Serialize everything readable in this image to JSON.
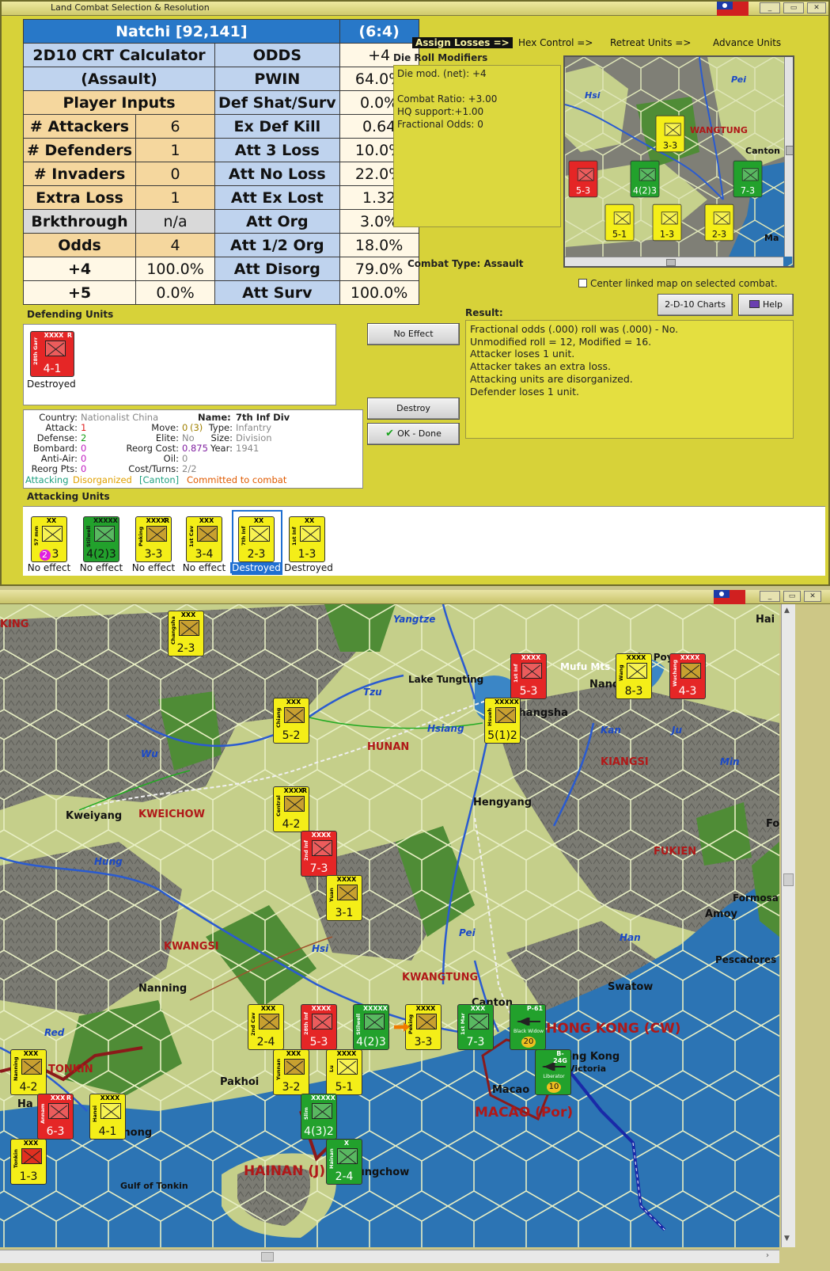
{
  "dialog": {
    "title": "Land Combat Selection & Resolution",
    "crt": {
      "location": "Natchi [92,141]",
      "ratio": "(6:4)",
      "calc_title1": "2D10 CRT Calculator",
      "calc_title2": "(Assault)",
      "player_inputs": "Player Inputs",
      "inputs": [
        {
          "label": "# Attackers",
          "value": "6"
        },
        {
          "label": "# Defenders",
          "value": "1"
        },
        {
          "label": "# Invaders",
          "value": "0"
        },
        {
          "label": "Extra Loss",
          "value": "1"
        },
        {
          "label": "Brkthrough",
          "value": "n/a"
        },
        {
          "label": "Odds",
          "value": "4"
        },
        {
          "label": "+4",
          "value": "100.0%"
        },
        {
          "label": "+5",
          "value": "0.0%"
        }
      ],
      "results": [
        {
          "label": "ODDS",
          "value": "+4"
        },
        {
          "label": "PWIN",
          "value": "64.0%"
        },
        {
          "label": "Def Shat/Surv",
          "value": "0.0%"
        },
        {
          "label": "Ex Def Kill",
          "value": "0.64"
        },
        {
          "label": "Att 3 Loss",
          "value": "10.0%"
        },
        {
          "label": "Att No Loss",
          "value": "22.0%"
        },
        {
          "label": "Att Ex Lost",
          "value": "1.32"
        },
        {
          "label": "Att Org",
          "value": "3.0%"
        },
        {
          "label": "Att 1/2 Org",
          "value": "18.0%"
        },
        {
          "label": "Att Disorg",
          "value": "79.0%"
        },
        {
          "label": "Att Surv",
          "value": "100.0%"
        }
      ]
    },
    "steps": {
      "assign": "Assign Losses =>",
      "hex": "Hex Control =>",
      "retreat": "Retreat Units =>",
      "advance": "Advance Units"
    },
    "drm": {
      "title": "Die Roll Modifiers",
      "lines": [
        "Die mod. (net): +4",
        "",
        "Combat Ratio: +3.00",
        "HQ support:+1.00",
        "Fractional Odds: 0"
      ]
    },
    "combat_type_label": "Combat Type:",
    "combat_type_value": "Assault",
    "center_link": "Center linked map on selected combat.",
    "buttons": {
      "charts": "2-D-10 Charts",
      "help": "Help",
      "no_effect": "No Effect",
      "destroy": "Destroy",
      "ok": "OK - Done"
    },
    "result": {
      "label": "Result:",
      "lines": [
        "Fractional odds (.000) roll was (.000)  - No.",
        "Unmodified roll = 12, Modified = 16.",
        "Attacker loses 1 unit.",
        "Attacker takes an extra loss.",
        "Attacking units are disorganized.",
        "Defender loses 1 unit."
      ]
    },
    "defending": {
      "label": "Defending Units",
      "units": [
        {
          "name": "28th Garr",
          "size": "XXXX",
          "strength": "4-1",
          "flag": "R",
          "status": "Destroyed",
          "color": "#e52626"
        }
      ]
    },
    "info": {
      "country_label": "Country:",
      "country": "Nationalist China",
      "attack_label": "Attack:",
      "attack": "1",
      "defense_label": "Defense:",
      "defense": "2",
      "bombard_label": "Bombard:",
      "bombard": "0",
      "antiair_label": "Anti-Air:",
      "antiair": "0",
      "reorg_label": "Reorg Pts:",
      "reorg": "0",
      "move_label": "Move:",
      "move": "0",
      "move_paren": "(3)",
      "elite_label": "Elite:",
      "elite": "No",
      "reorg_cost_label": "Reorg Cost:",
      "reorg_cost": "0.875",
      "oil_label": "Oil:",
      "oil": "0",
      "cost_label": "Cost/Turns:",
      "cost": "2/2",
      "name_label": "Name:",
      "name": "7th Inf Div",
      "type_label": "Type:",
      "type": "Infantry",
      "size_label": "Size:",
      "size": "Division",
      "year_label": "Year:",
      "year": "1941",
      "status_attacking": "Attacking",
      "status_disorganized": "Disorganized",
      "status_location": "[Canton]",
      "status_committed": "Committed to combat"
    },
    "attacking": {
      "label": "Attacking Units",
      "units": [
        {
          "name": "57 mm",
          "size": "XX",
          "strength": "3",
          "extra": "2",
          "color": "y",
          "status": "No effect"
        },
        {
          "name": "Stilwell",
          "size": "XXXXX",
          "strength": "4(2)3",
          "color": "g",
          "status": "No effect"
        },
        {
          "name": "Peking",
          "size": "XXXX",
          "strength": "3-3",
          "flag": "R",
          "color": "y",
          "status": "No effect"
        },
        {
          "name": "1st Cav",
          "size": "XXX",
          "strength": "3-4",
          "color": "y",
          "status": "No effect"
        },
        {
          "name": "7th Inf Div",
          "size": "XX",
          "strength": "2-3",
          "color": "y",
          "status": "Destroyed",
          "selected": true
        },
        {
          "name": "1st Inf Div",
          "size": "XX",
          "strength": "1-3",
          "color": "y",
          "status": "Destroyed"
        }
      ]
    }
  },
  "map": {
    "provinces": [
      "HUNAN",
      "KWEICHOW",
      "KIANGSI",
      "FUKIEN",
      "KWANGSI",
      "KWANGTUNG",
      "HONG KONG (CW)",
      "MACAO (Por)",
      "HAINAN (J)",
      "TONKIN",
      "KING"
    ],
    "cities": [
      "Kweiyang",
      "Hengyang",
      "Nanning",
      "Swatow",
      "Canton",
      "Amoy",
      "Pakhoi",
      "Macao",
      "Hong Kong",
      "Victoria",
      "Haiphong",
      "Kiungchow",
      "Nanc",
      "Changsha",
      "Ha",
      "Fo",
      "Hai"
    ],
    "geo": [
      "Lake Tungting",
      "Mufu Mts",
      "Lake Poyang",
      "Formosa",
      "Pescadores",
      "Gulf of Tonkin"
    ],
    "rivers": [
      "Yangtze",
      "Tzu",
      "Hsiang",
      "Kan",
      "Ju",
      "Wu",
      "Min",
      "Hung",
      "Hsi",
      "Pei",
      "Han",
      "Red"
    ],
    "minimap_labels": [
      "Hsi",
      "Pei",
      "WANGTUNG",
      "Canton",
      "Ma"
    ],
    "units": [
      {
        "name": "Changsha",
        "size": "XXX",
        "strength": "2-3",
        "color": "y"
      },
      {
        "name": "1st Inf",
        "size": "XXXX",
        "strength": "5-3",
        "color": "r"
      },
      {
        "name": "Wang",
        "size": "XXXX",
        "strength": "8-3",
        "color": "y"
      },
      {
        "name": "Wuchang",
        "size": "XXXX",
        "strength": "4-3",
        "color": "r"
      },
      {
        "name": "Chiang",
        "size": "XXX",
        "strength": "5-2",
        "color": "y"
      },
      {
        "name": "Hsueh",
        "size": "XXXXX",
        "strength": "5(1)2",
        "color": "y"
      },
      {
        "name": "Central",
        "size": "XXXX",
        "strength": "4-2",
        "flag": "R",
        "color": "y"
      },
      {
        "name": "2nd Inf",
        "size": "XXXX",
        "strength": "7-3",
        "color": "r"
      },
      {
        "name": "Yuan",
        "size": "XXXX",
        "strength": "3-1",
        "color": "y"
      },
      {
        "name": "2nd Cav",
        "size": "XXX",
        "strength": "2-4",
        "color": "y"
      },
      {
        "name": "28th Inf",
        "size": "XXXX",
        "strength": "5-3",
        "color": "r"
      },
      {
        "name": "Stilwell",
        "size": "XXXXX",
        "strength": "4(2)3",
        "color": "g"
      },
      {
        "name": "Peking",
        "size": "XXXX",
        "strength": "3-3",
        "color": "y"
      },
      {
        "name": "1st Mar",
        "size": "XXX",
        "strength": "7-3",
        "color": "g"
      },
      {
        "name": "Yunnan",
        "size": "XXX",
        "strength": "3-2",
        "color": "y"
      },
      {
        "name": "Lu",
        "size": "XXXX",
        "strength": "5-1",
        "color": "y"
      },
      {
        "name": "Nanning",
        "size": "XXX",
        "strength": "4-2",
        "color": "y"
      },
      {
        "name": "Annam",
        "size": "XXX",
        "strength": "6-3",
        "flag": "R",
        "color": "r"
      },
      {
        "name": "Hanoi",
        "size": "XXXX",
        "strength": "4-1",
        "color": "y"
      },
      {
        "name": "Slim",
        "size": "XXXXX",
        "strength": "4(3)2",
        "color": "g"
      },
      {
        "name": "Hainan",
        "size": "X",
        "strength": "2-4",
        "color": "g"
      },
      {
        "name": "Tonkin",
        "size": "XXX",
        "strength": "1-3",
        "color": "y"
      }
    ],
    "air": [
      {
        "name": "Black Widow",
        "type": "P-61",
        "value": "20"
      },
      {
        "name": "Liberator",
        "type": "B-24G",
        "value": "10"
      }
    ]
  },
  "colors": {
    "dialog_bg": "#d7d239",
    "crt_head": "#2878c8",
    "crt_blue": "#bfd3ee",
    "crt_orange": "#f5d79e",
    "sea": "#2c74b4",
    "mountain": "#7a7a72",
    "plains": "#c8d08a",
    "forest": "#4f8c36"
  }
}
